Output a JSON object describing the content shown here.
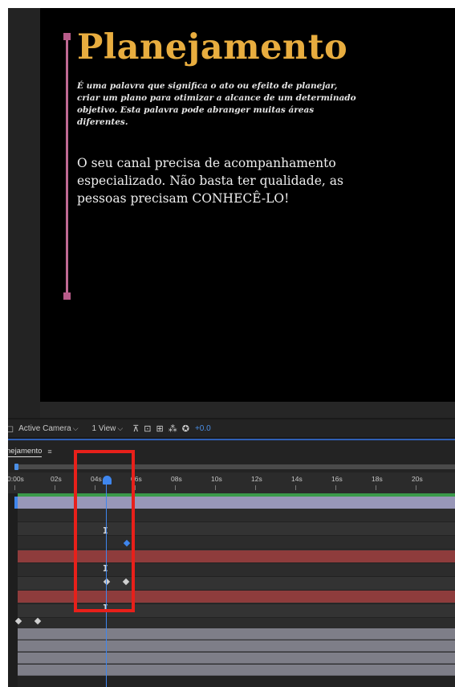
{
  "viewer": {
    "title": "Planejamento",
    "definition": "É uma palavra que significa o ato ou efeito de planejar, criar um plano para otimizar a alcance de um determinado objetivo. Esta palavra pode abranger muitas áreas diferentes.",
    "message": "O seu canal precisa de acompanhamento especializado. Não basta ter qualidade, as pessoas precisam CONHECÊ-LO!"
  },
  "viewer_toolbar": {
    "camera_select": "Active Camera",
    "view_select": "1 View",
    "exposure_value": "+0.0",
    "icons": [
      "render-options-icon",
      "fast-preview-icon",
      "grid-icon",
      "3d-view-icon",
      "flowchart-icon",
      "reset-exposure-icon"
    ]
  },
  "timeline": {
    "tab_label": "nejamento",
    "ruler_ticks": [
      "0:00s",
      "02s",
      "04s",
      "06s",
      "08s",
      "10s",
      "12s",
      "14s",
      "16s",
      "18s",
      "20s"
    ],
    "current_time_seconds": 4.2
  },
  "colors": {
    "title_gold": "#e8ad3f",
    "accent_pink": "#c06a94",
    "cti_blue": "#3f86ee",
    "highlight_red": "#e8201a",
    "track_red": "#8e3c3c",
    "track_lavender": "#9897b8"
  }
}
